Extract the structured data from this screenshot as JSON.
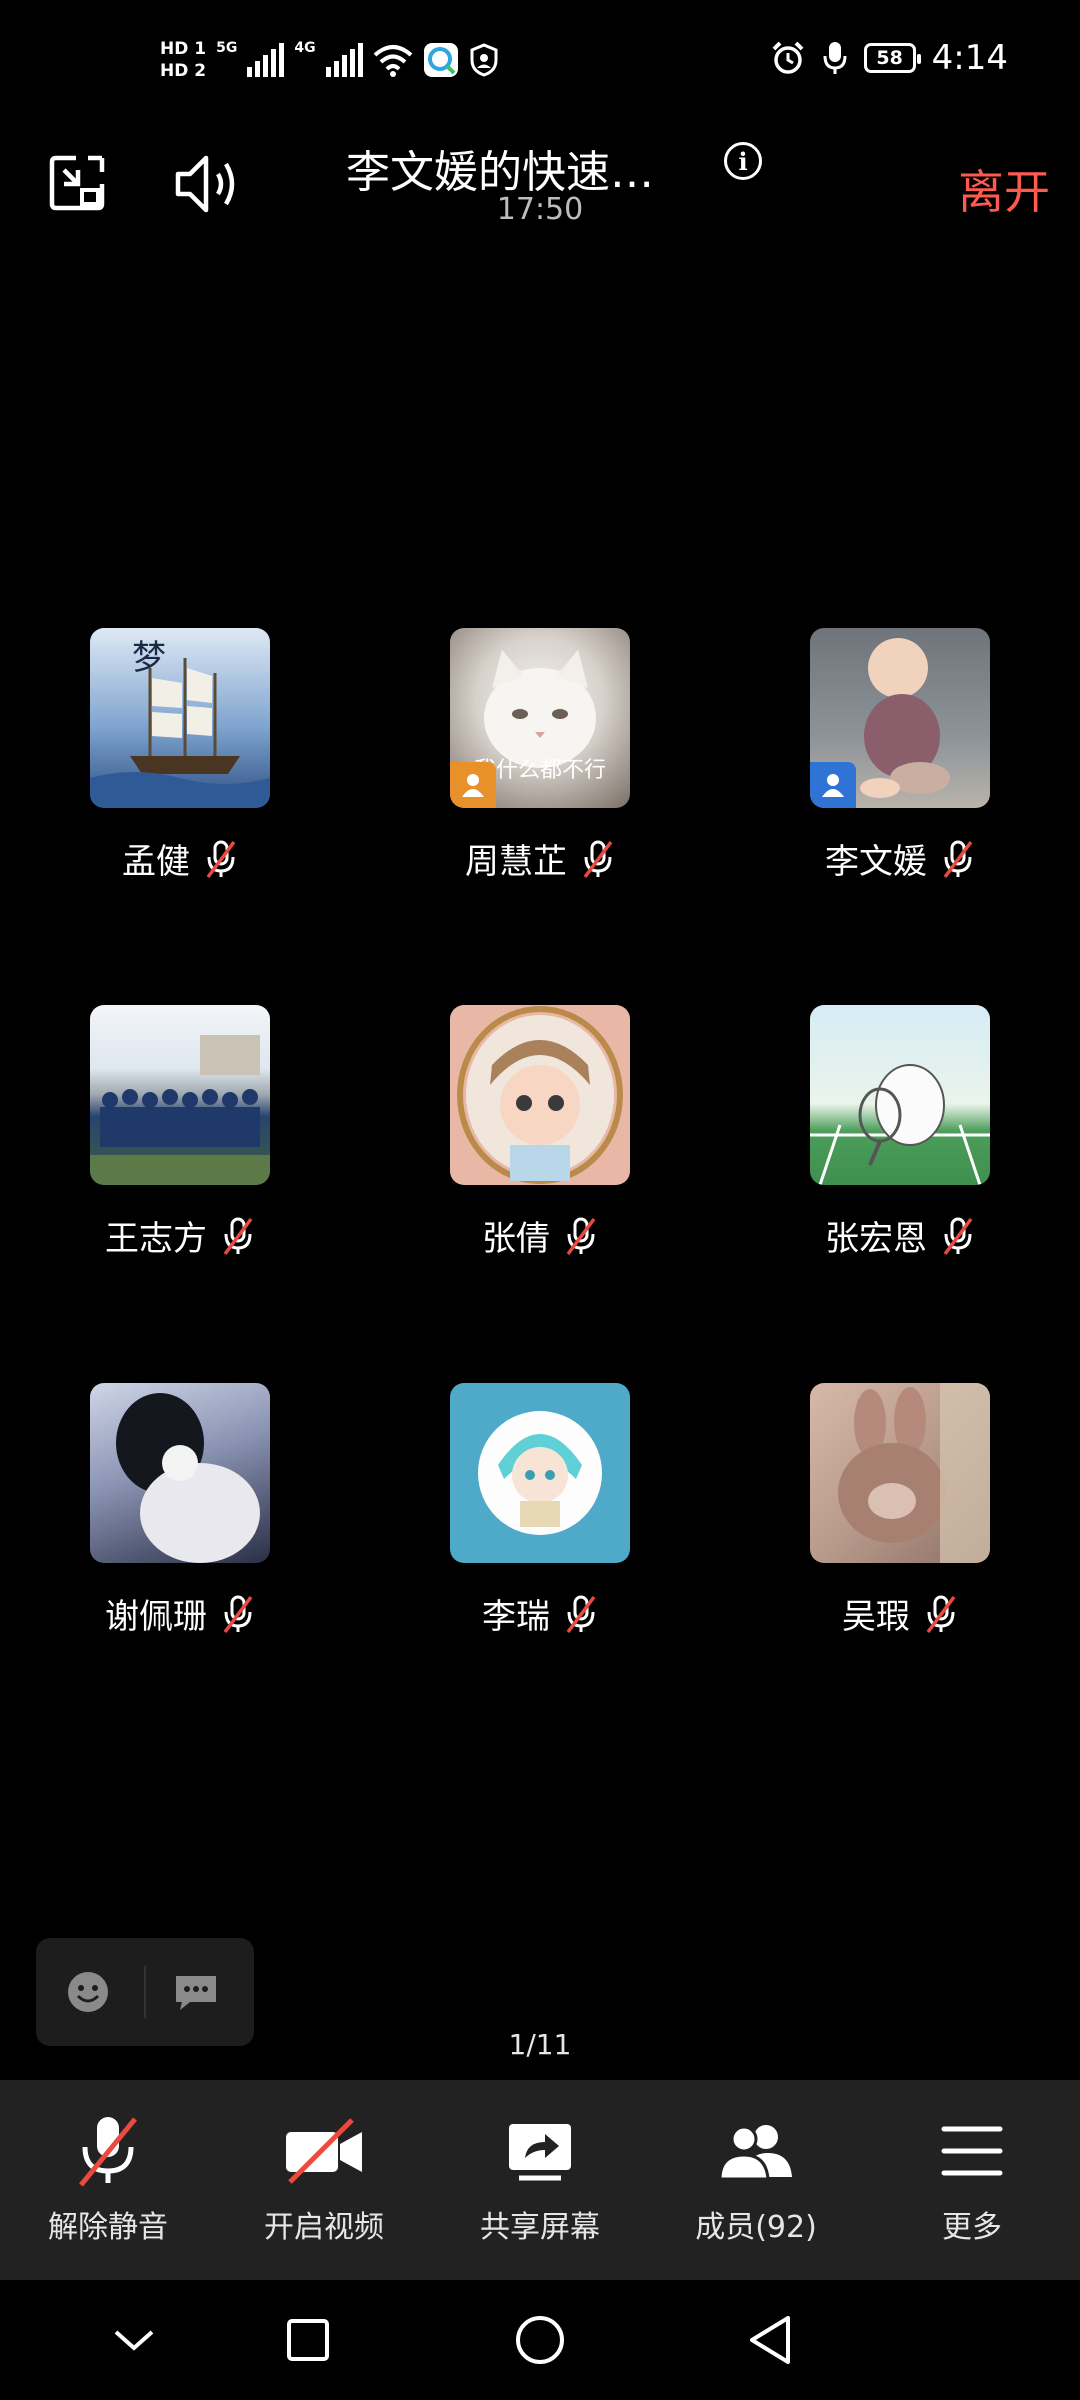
{
  "status_bar": {
    "hd1": "HD 1",
    "hd2": "HD 2",
    "net1": "5G",
    "net2": "4G",
    "battery": "58",
    "time": "4:14"
  },
  "header": {
    "title": "李文媛的快速…",
    "duration": "17:50",
    "leave_label": "离开"
  },
  "participants": [
    {
      "name": "孟健",
      "avatar_caption": "梦",
      "avatar_colors": [
        "#7fa4cf",
        "#2c4e82"
      ]
    },
    {
      "name": "周慧芷",
      "avatar_caption": "我什么都不行",
      "avatar_colors": [
        "#d8d2cc",
        "#7a6f66"
      ],
      "badge_color": "#e8902a"
    },
    {
      "name": "李文媛",
      "avatar_colors": [
        "#8c9399",
        "#c9b7a8"
      ],
      "badge_color": "#2f74d4"
    },
    {
      "name": "王志方",
      "avatar_colors": [
        "#dfe7ef",
        "#3f5f3a"
      ]
    },
    {
      "name": "张倩",
      "avatar_colors": [
        "#f2c3b2",
        "#d99a8a"
      ]
    },
    {
      "name": "张宏恩",
      "avatar_colors": [
        "#cfe6f2",
        "#4c9e5a"
      ]
    },
    {
      "name": "谢佩珊",
      "avatar_colors": [
        "#b9c3db",
        "#2a2f45"
      ]
    },
    {
      "name": "李瑞",
      "avatar_colors": [
        "#5cb3cf",
        "#3a97b8"
      ]
    },
    {
      "name": "吴瑕",
      "avatar_colors": [
        "#d7b9a8",
        "#8a7064"
      ]
    }
  ],
  "page_indicator": "1/11",
  "toolbar": {
    "unmute": "解除静音",
    "video": "开启视频",
    "share": "共享屏幕",
    "members": "成员(92)",
    "more": "更多"
  },
  "colors": {
    "leave": "#ff5a4f",
    "mute_slash": "#e84a3f"
  }
}
